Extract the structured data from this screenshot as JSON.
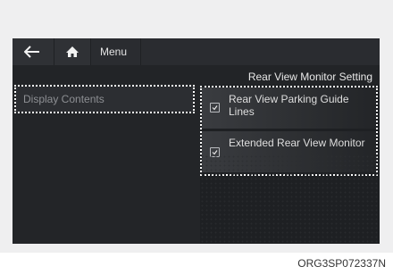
{
  "topbar": {
    "back_icon": "arrow-left-icon",
    "home_icon": "home-icon",
    "menu_label": "Menu"
  },
  "panel": {
    "title": "Rear View Monitor Setting"
  },
  "left_menu": {
    "items": [
      {
        "label": "Display Contents"
      }
    ]
  },
  "options": [
    {
      "label": "Rear View Parking Guide Lines",
      "checked": true
    },
    {
      "label": "Extended Rear View Monitor",
      "checked": true
    }
  ],
  "caption": "ORG3SP072337N",
  "colors": {
    "screen_bg": "#222427",
    "highlight_outline": "#ffffff"
  }
}
